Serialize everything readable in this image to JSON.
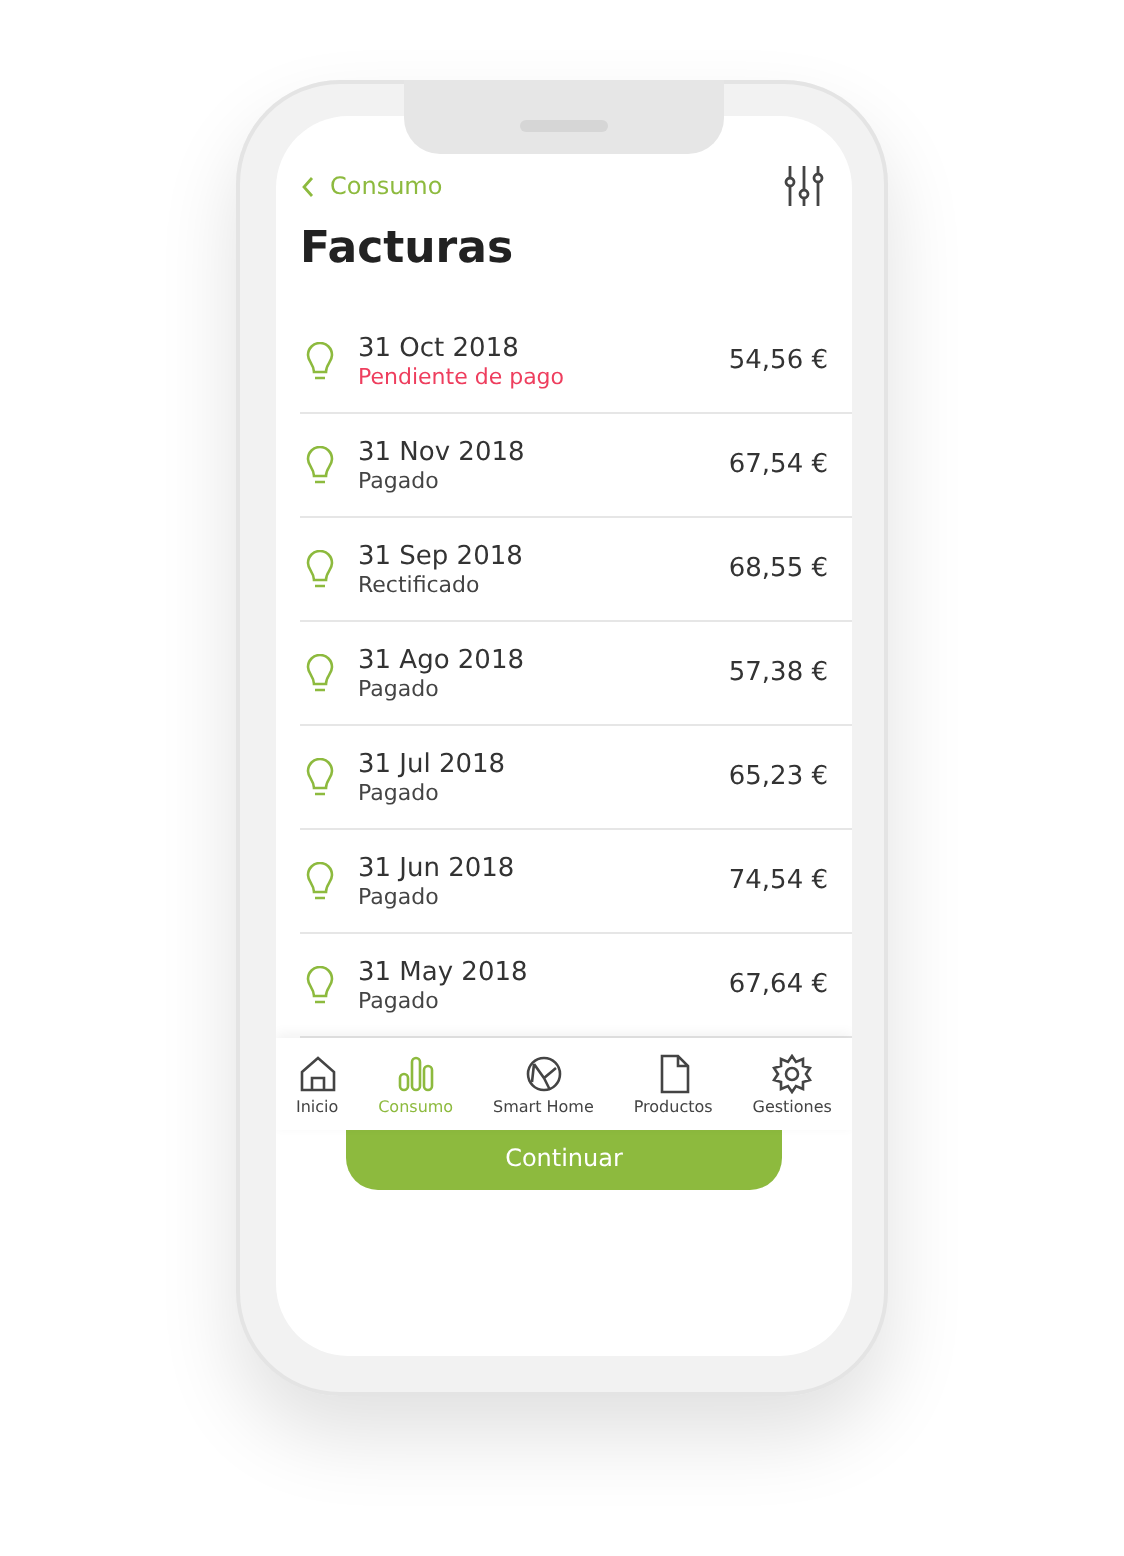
{
  "header": {
    "back_label": "Consumo",
    "title": "Facturas"
  },
  "invoices": [
    {
      "date": "31 Oct 2018",
      "status": "Pendiente de pago",
      "kind": "pending",
      "amount": "54,56 €"
    },
    {
      "date": "31 Nov 2018",
      "status": "Pagado",
      "kind": "normal",
      "amount": "67,54 €"
    },
    {
      "date": "31 Sep 2018",
      "status": "Rectificado",
      "kind": "normal",
      "amount": "68,55 €"
    },
    {
      "date": "31 Ago 2018",
      "status": "Pagado",
      "kind": "normal",
      "amount": "57,38 €"
    },
    {
      "date": "31 Jul 2018",
      "status": "Pagado",
      "kind": "normal",
      "amount": "65,23 €"
    },
    {
      "date": "31 Jun 2018",
      "status": "Pagado",
      "kind": "normal",
      "amount": "74,54 €"
    },
    {
      "date": "31 May 2018",
      "status": "Pagado",
      "kind": "normal",
      "amount": "67,64 €"
    }
  ],
  "tab_bar": [
    {
      "label": "Inicio",
      "kind": "home",
      "selected": false
    },
    {
      "label": "Consumo",
      "kind": "chart",
      "selected": true
    },
    {
      "label": "Smart Home",
      "kind": "network",
      "selected": false
    },
    {
      "label": "Productos",
      "kind": "document",
      "selected": false
    },
    {
      "label": "Gestiones",
      "kind": "gear",
      "selected": false
    }
  ],
  "button": "Continuar"
}
